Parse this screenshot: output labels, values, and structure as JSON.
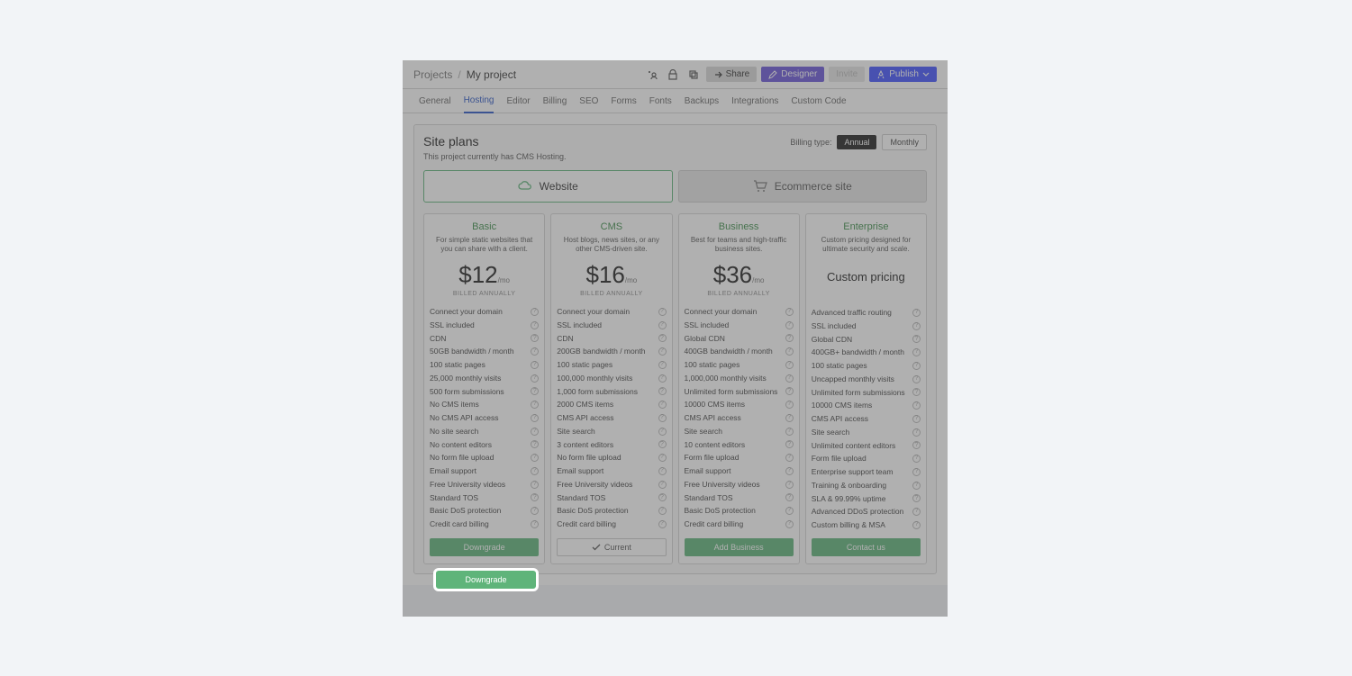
{
  "breadcrumb": {
    "root": "Projects",
    "sep": "/",
    "current": "My project"
  },
  "top_actions": {
    "share": "Share",
    "designer": "Designer",
    "invite": "Invite",
    "publish": "Publish"
  },
  "tabs": [
    "General",
    "Hosting",
    "Editor",
    "Billing",
    "SEO",
    "Forms",
    "Fonts",
    "Backups",
    "Integrations",
    "Custom Code"
  ],
  "active_tab": "Hosting",
  "panel": {
    "title": "Site plans",
    "subtitle": "This project currently has CMS Hosting.",
    "billing_label": "Billing type:",
    "billing_annual": "Annual",
    "billing_monthly": "Monthly"
  },
  "site_type": {
    "website": "Website",
    "ecommerce": "Ecommerce site"
  },
  "plans": [
    {
      "name": "Basic",
      "desc": "For simple static websites that you can share with a client.",
      "price": "$12",
      "per": "/mo",
      "billed": "BILLED ANNUALLY",
      "features": [
        "Connect your domain",
        "SSL included",
        "CDN",
        "50GB bandwidth / month",
        "100 static pages",
        "25,000 monthly visits",
        "500 form submissions",
        "No CMS items",
        "No CMS API access",
        "No site search",
        "No content editors",
        "No form file upload",
        "Email support",
        "Free University videos",
        "Standard TOS",
        "Basic DoS protection",
        "Credit card billing"
      ],
      "button": "Downgrade",
      "button_style": "green",
      "highlighted": true
    },
    {
      "name": "CMS",
      "desc": "Host blogs, news sites, or any other CMS-driven site.",
      "price": "$16",
      "per": "/mo",
      "billed": "BILLED ANNUALLY",
      "features": [
        "Connect your domain",
        "SSL included",
        "CDN",
        "200GB bandwidth / month",
        "100 static pages",
        "100,000 monthly visits",
        "1,000 form submissions",
        "2000 CMS items",
        "CMS API access",
        "Site search",
        "3 content editors",
        "No form file upload",
        "Email support",
        "Free University videos",
        "Standard TOS",
        "Basic DoS protection",
        "Credit card billing"
      ],
      "button": "Current",
      "button_style": "outline",
      "show_check": true
    },
    {
      "name": "Business",
      "desc": "Best for teams and high-traffic business sites.",
      "price": "$36",
      "per": "/mo",
      "billed": "BILLED ANNUALLY",
      "features": [
        "Connect your domain",
        "SSL included",
        "Global CDN",
        "400GB bandwidth / month",
        "100 static pages",
        "1,000,000 monthly visits",
        "Unlimited form submissions",
        "10000 CMS items",
        "CMS API access",
        "Site search",
        "10 content editors",
        "Form file upload",
        "Email support",
        "Free University videos",
        "Standard TOS",
        "Basic DoS protection",
        "Credit card billing"
      ],
      "button": "Add Business",
      "button_style": "green"
    },
    {
      "name": "Enterprise",
      "desc": "Custom pricing designed for ultimate security and scale.",
      "custom_price": "Custom pricing",
      "features": [
        "Advanced traffic routing",
        "SSL included",
        "Global CDN",
        "400GB+ bandwidth / month",
        "100 static pages",
        "Uncapped monthly visits",
        "Unlimited form submissions",
        "10000 CMS items",
        "CMS API access",
        "Site search",
        "Unlimited content editors",
        "Form file upload",
        "Enterprise support team",
        "Training & onboarding",
        "SLA & 99.99% uptime",
        "Advanced DDoS protection",
        "Custom billing & MSA"
      ],
      "button": "Contact us",
      "button_style": "green"
    }
  ]
}
